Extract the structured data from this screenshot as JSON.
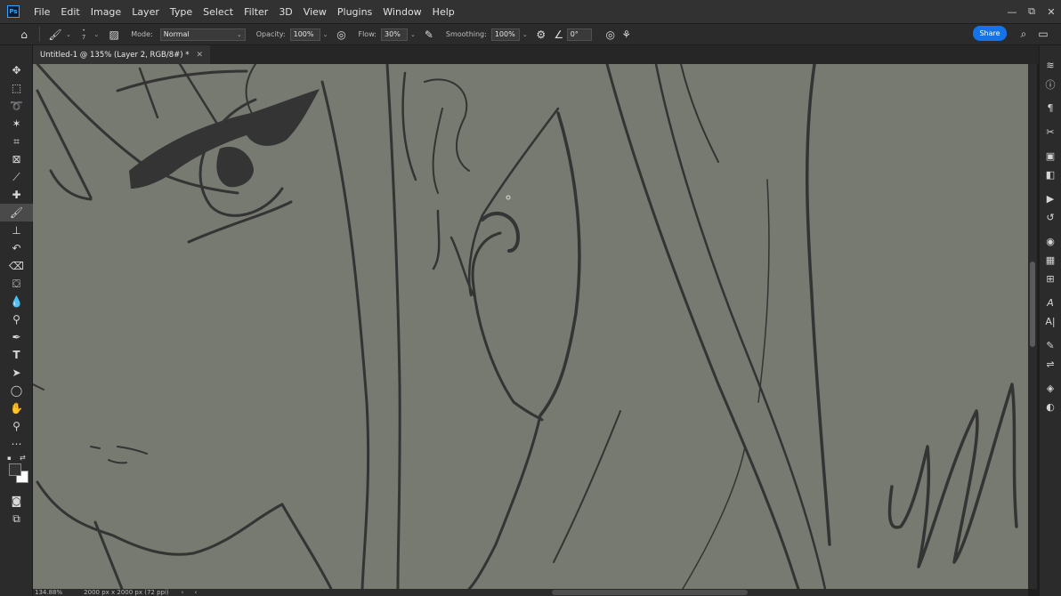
{
  "menubar": {
    "logo": "Ps",
    "items": [
      "File",
      "Edit",
      "Image",
      "Layer",
      "Type",
      "Select",
      "Filter",
      "3D",
      "View",
      "Plugins",
      "Window",
      "Help"
    ],
    "window_controls": [
      "—",
      "⧉",
      "✕"
    ]
  },
  "options": {
    "brush_size": "7",
    "mode_label": "Mode:",
    "mode_value": "Normal",
    "opacity_label": "Opacity:",
    "opacity_value": "100%",
    "flow_label": "Flow:",
    "flow_value": "30%",
    "smoothing_label": "Smoothing:",
    "smoothing_value": "100%",
    "angle_value": "0°",
    "share_label": "Share"
  },
  "document": {
    "tab_title": "Untitled-1 @ 135% (Layer 2, RGB/8#) *",
    "zoom": "134.88%",
    "doc_info": "2000 px x 2000 px (72 ppi)"
  },
  "colors": {
    "canvas_bg": "#777a70",
    "ink": "#343434",
    "accent": "#1473e6"
  }
}
